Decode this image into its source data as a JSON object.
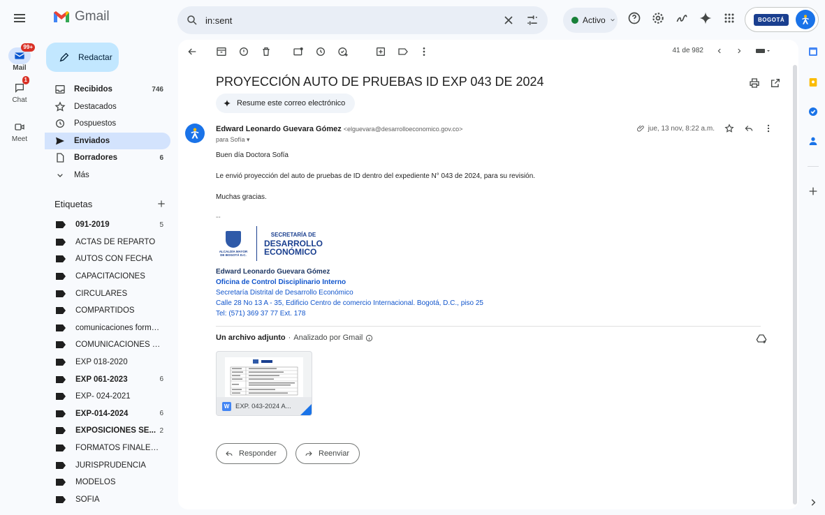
{
  "app": {
    "name": "Gmail"
  },
  "search": {
    "value": "in:sent"
  },
  "status": {
    "label": "Activo"
  },
  "account": {
    "org_logo_text": "BOGOTÁ"
  },
  "rail": {
    "mail_label": "Mail",
    "mail_badge": "99+",
    "chat_label": "Chat",
    "chat_badge": "1",
    "meet_label": "Meet"
  },
  "compose": {
    "label": "Redactar"
  },
  "nav": {
    "items": [
      {
        "label": "Recibidos",
        "count": "746"
      },
      {
        "label": "Destacados",
        "count": ""
      },
      {
        "label": "Pospuestos",
        "count": ""
      },
      {
        "label": "Enviados",
        "count": ""
      },
      {
        "label": "Borradores",
        "count": "6"
      },
      {
        "label": "Más",
        "count": ""
      }
    ]
  },
  "labels": {
    "title": "Etiquetas",
    "items": [
      {
        "label": "091-2019",
        "count": "5"
      },
      {
        "label": "ACTAS DE REPARTO",
        "count": ""
      },
      {
        "label": "AUTOS CON FECHA",
        "count": ""
      },
      {
        "label": "CAPACITACIONES",
        "count": ""
      },
      {
        "label": "CIRCULARES",
        "count": ""
      },
      {
        "label": "COMPARTIDOS",
        "count": ""
      },
      {
        "label": "comunicaciones formato...",
        "count": ""
      },
      {
        "label": "COMUNICACIONES Y/O ...",
        "count": ""
      },
      {
        "label": "EXP 018-2020",
        "count": ""
      },
      {
        "label": "EXP 061-2023",
        "count": "6"
      },
      {
        "label": "EXP- 024-2021",
        "count": ""
      },
      {
        "label": "EXP-014-2024",
        "count": "6"
      },
      {
        "label": "EXPOSICIONES SE...",
        "count": "2"
      },
      {
        "label": "FORMATOS FINALES PR...",
        "count": ""
      },
      {
        "label": "JURISPRUDENCIA",
        "count": ""
      },
      {
        "label": "MODELOS",
        "count": ""
      },
      {
        "label": "SOFÍA",
        "count": ""
      }
    ]
  },
  "toolbar": {
    "pager": "41 de 982"
  },
  "email": {
    "subject": "PROYECCIÓN AUTO DE PRUEBAS ID EXP 043 DE 2024",
    "summarize": "Resume este correo electrónico",
    "sender_name": "Edward Leonardo Guevara Gómez",
    "sender_email": "<elguevara@desarrolloeconomico.gov.co>",
    "to": "para Sofía",
    "date": "jue, 13 nov, 8:22 a.m.",
    "greeting": "Buen día Doctora Sofía",
    "body": "Le envió proyección del auto de pruebas de ID dentro del expediente N° 043 de 2024, para su revisión.",
    "closing": "Muchas gracias.",
    "sep": "--",
    "logo_alcaldia": "ALCALDÍA MAYOR DE BOGOTÁ D.C.",
    "logo_sec1": "SECRETARÍA DE",
    "logo_sec2": "DESARROLLO",
    "logo_sec3": "ECONÓMICO",
    "sig_name": "Edward Leonardo Guevara Gómez",
    "sig_office": "Oficina de Control Disciplinario Interno",
    "sig_org": "Secretaría Distrital de Desarrollo Económico",
    "sig_address": "Calle 28 No 13 A - 35, Edificio Centro de comercio Internacional. Bogotá, D.C., piso 25",
    "sig_tel": "Tel: (571) 369 37 77 Ext. 178",
    "attach_title": "Un archivo adjunto",
    "attach_sub": "Analizado por Gmail",
    "attach_name": "EXP. 043-2024 A...",
    "reply": "Responder",
    "forward": "Reenviar"
  }
}
